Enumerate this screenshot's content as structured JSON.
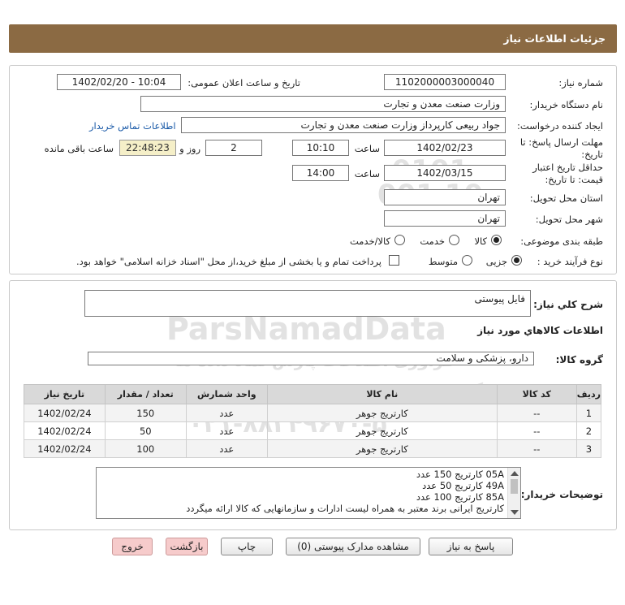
{
  "header": {
    "title": "جزئیات اطلاعات نیاز"
  },
  "form": {
    "need_number_label": "شماره نیاز:",
    "need_number": "1102000003000040",
    "announce_label": "تاریخ و ساعت اعلان عمومی:",
    "announce_value": "1402/02/20 - 10:04",
    "buyer_org_label": "نام دستگاه خریدار:",
    "buyer_org": "وزارت صنعت معدن و تجارت",
    "creator_label": "ایجاد کننده درخواست:",
    "creator": "جواد ربیعی کارپرداز وزارت صنعت معدن و تجارت",
    "contact_link": "اطلاعات تماس خریدار",
    "deadline_label_1": "مهلت ارسال پاسخ: تا",
    "deadline_label_2": "تاریخ:",
    "deadline_date": "1402/02/23",
    "time_label": "ساعت",
    "deadline_time": "10:10",
    "days_value": "2",
    "days_label": "روز و",
    "remaining_time": "22:48:23",
    "remaining_label": "ساعت باقی مانده",
    "validity_label_1": "حداقل تاریخ اعتبار",
    "validity_label_2": "قیمت: تا تاریخ:",
    "validity_date": "1402/03/15",
    "validity_time": "14:00",
    "province_label": "استان محل تحویل:",
    "province": "تهران",
    "city_label": "شهر محل تحویل:",
    "city": "تهران",
    "category_label": "طبقه بندی موضوعی:",
    "category_options": [
      "کالا",
      "خدمت",
      "کالا/خدمت"
    ],
    "process_label": "نوع فرآیند خرید :",
    "process_options": [
      "جزیی",
      "متوسط"
    ],
    "payment_note": "پرداخت تمام و یا بخشی از مبلغ خرید،از محل \"اسناد خزانه اسلامی\" خواهد بود."
  },
  "details": {
    "summary_label": "شرح کلي نیاز:",
    "summary_value": "فایل پیوستی",
    "goods_info_title": "اطلاعات کالاهاي مورد نیاز",
    "goods_group_label": "گروه کالا:",
    "goods_group_value": "دارو، پزشکی و سلامت",
    "table": {
      "headers": [
        "ردیف",
        "کد کالا",
        "نام کالا",
        "واحد شمارش",
        "تعداد / مقدار",
        "تاریخ نیاز"
      ],
      "rows": [
        [
          "1",
          "--",
          "کارتریج جوهر",
          "عدد",
          "150",
          "1402/02/24"
        ],
        [
          "2",
          "--",
          "کارتریج جوهر",
          "عدد",
          "50",
          "1402/02/24"
        ],
        [
          "3",
          "--",
          "کارتریج جوهر",
          "عدد",
          "100",
          "1402/02/24"
        ]
      ]
    },
    "buyer_notes_label": "توضیحات خریدار:",
    "buyer_notes": [
      "05A کارتریج  150  عدد",
      "49A   کارتریج 50  عدد",
      "85A   کارتریج  100  عدد",
      "کارتریج ایرانی برند معتبر به همراه لیست ادارات و سازمانهایی که کالا ارائه میگردد"
    ]
  },
  "buttons": {
    "reply": "پاسخ به نیاز",
    "view_docs": "مشاهده مدارک پیوستی (0)",
    "print": "چاپ",
    "back": "بازگشت",
    "exit": "خروج"
  },
  "watermark": {
    "brand": "ParsNamadData",
    "fa_line_1": "فراوری اطلاعات پارس نماد داده ها",
    "fa_line_2": "پایگاه اطلاع رسانی مناقصات و مزایده",
    "phone": "۰۲۱-۸۸۳۴۹۶۷۰-۵",
    "number": "0101 001 10"
  }
}
